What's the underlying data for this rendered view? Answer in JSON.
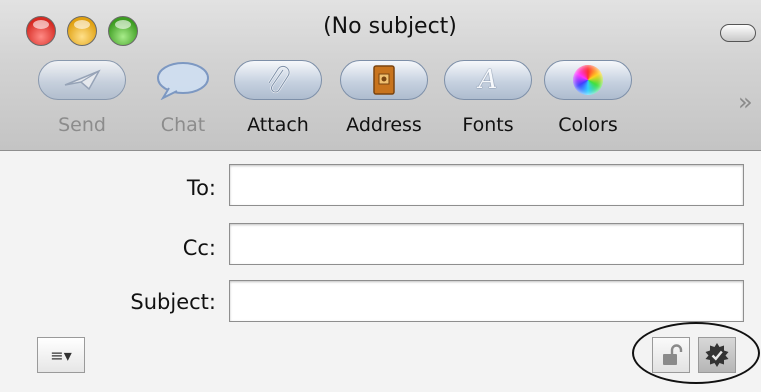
{
  "window": {
    "title": "(No subject)"
  },
  "toolbar": {
    "items": [
      {
        "label": "Send",
        "icon": "send-icon",
        "enabled": false
      },
      {
        "label": "Chat",
        "icon": "chat-icon",
        "enabled": false
      },
      {
        "label": "Attach",
        "icon": "paperclip-icon",
        "enabled": true
      },
      {
        "label": "Address",
        "icon": "address-book-icon",
        "enabled": true
      },
      {
        "label": "Fonts",
        "icon": "fonts-icon",
        "enabled": true
      },
      {
        "label": "Colors",
        "icon": "color-wheel-icon",
        "enabled": true
      }
    ],
    "overflow": "»"
  },
  "fields": {
    "to": {
      "label": "To:",
      "value": ""
    },
    "cc": {
      "label": "Cc:",
      "value": ""
    },
    "subject": {
      "label": "Subject:",
      "value": ""
    }
  },
  "bottom": {
    "format_menu": "≡▾"
  }
}
